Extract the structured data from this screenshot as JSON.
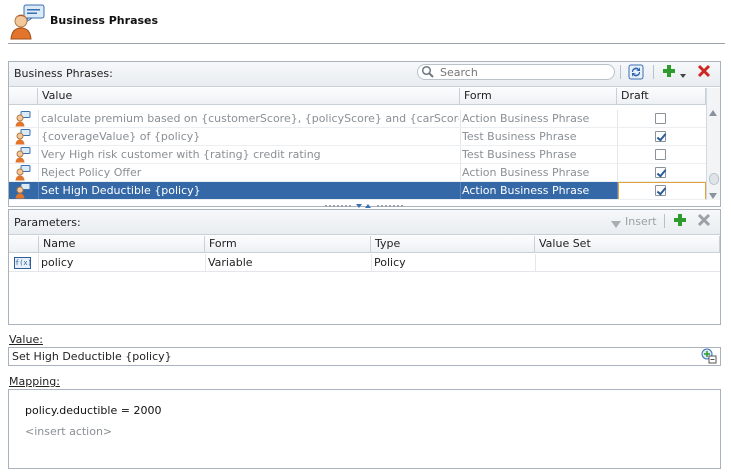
{
  "header": {
    "title": "Business Phrases",
    "icon": "business-phrase-person-icon"
  },
  "business_phrases": {
    "label": "Business Phrases:",
    "search": {
      "placeholder": "Search",
      "value": ""
    },
    "toolbar_icons": [
      "refresh-icon",
      "add-icon",
      "add-menu-icon",
      "delete-icon"
    ],
    "columns": [
      "Value",
      "Form",
      "Draft"
    ],
    "rows": [
      {
        "value": "calculate premium based on {customerScore}, {policyScore} and {carScore}",
        "form": "Action Business Phrase",
        "draft": false,
        "selected": false
      },
      {
        "value": "{coverageValue} of {policy}",
        "form": "Test Business Phrase",
        "draft": true,
        "selected": false
      },
      {
        "value": "Very High risk customer with {rating} credit rating",
        "form": "Test Business Phrase",
        "draft": false,
        "selected": false
      },
      {
        "value": "Reject Policy Offer",
        "form": "Action Business Phrase",
        "draft": true,
        "selected": false
      },
      {
        "value": "Set High Deductible {policy}",
        "form": "Action Business Phrase",
        "draft": true,
        "selected": true
      }
    ]
  },
  "parameters": {
    "label": "Parameters:",
    "insert_label": "Insert",
    "columns": [
      "Name",
      "Form",
      "Type",
      "Value Set"
    ],
    "rows": [
      {
        "icon_text": "f(x)",
        "name": "policy",
        "form": "Variable",
        "type": "Policy",
        "value_set": ""
      }
    ]
  },
  "value_field": {
    "label": "Value:",
    "value": "Set High Deductible {policy}"
  },
  "mapping": {
    "label": "Mapping:",
    "lines": [
      "policy.deductible = 2000",
      "<insert action>"
    ]
  },
  "colors": {
    "selection": "#3568a6",
    "add": "#2e9b2e",
    "delete": "#d0261f",
    "focus_border": "#e3a23a"
  }
}
